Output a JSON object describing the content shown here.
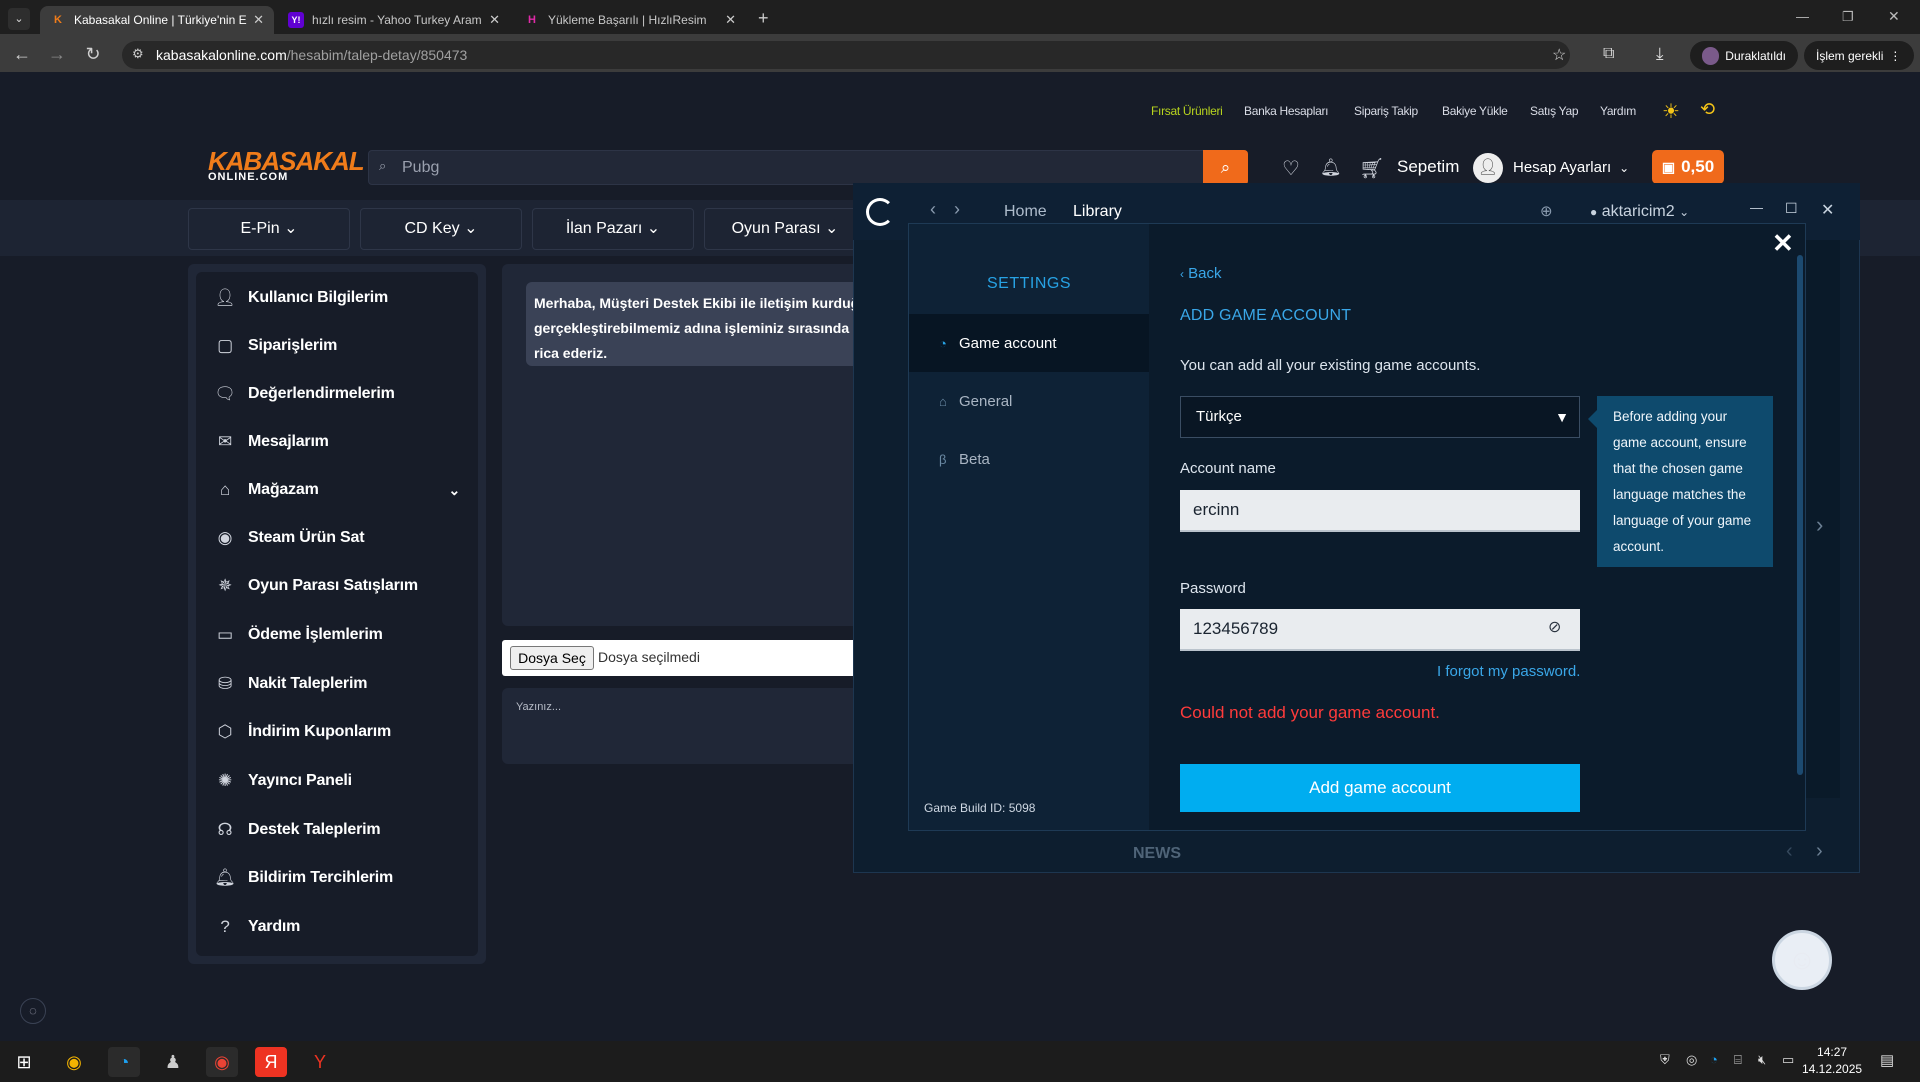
{
  "browser": {
    "tabs": [
      {
        "title": "Kabasakal Online | Türkiye'nin E",
        "favicon": "K"
      },
      {
        "title": "hızlı resim - Yahoo Turkey Aram",
        "favicon": "Y!"
      },
      {
        "title": "Yükleme Başarılı | HızlıResim",
        "favicon": "H"
      }
    ],
    "url_domain": "kabasakalonline.com",
    "url_path": "/hesabim/talep-detay/850473",
    "paused_label": "Duraklatıldı",
    "action_label": "İşlem gerekli"
  },
  "site": {
    "top_links": [
      "Fırsat Ürünleri",
      "Banka Hesapları",
      "Sipariş Takip",
      "Bakiye Yükle",
      "Satış Yap",
      "Yardım"
    ],
    "logo_main": "KABASAKAL",
    "logo_sub": "ONLINE.COM",
    "search_value": "Pubg",
    "cart_label": "Sepetim",
    "account_label": "Hesap Ayarları",
    "balance": "0,50",
    "categories": [
      "E-Pin",
      "CD Key",
      "İlan Pazarı",
      "Oyun Parası"
    ],
    "sidebar": [
      {
        "label": "Kullanıcı Bilgilerim",
        "icon": "user-icon"
      },
      {
        "label": "Siparişlerim",
        "icon": "bag-icon"
      },
      {
        "label": "Değerlendirmelerim",
        "icon": "comment-icon"
      },
      {
        "label": "Mesajlarım",
        "icon": "mail-icon"
      },
      {
        "label": "Mağazam",
        "icon": "store-icon"
      },
      {
        "label": "Steam Ürün Sat",
        "icon": "steam-icon"
      },
      {
        "label": "Oyun Parası Satışlarım",
        "icon": "coins-icon"
      },
      {
        "label": "Ödeme İşlemlerim",
        "icon": "wallet-icon"
      },
      {
        "label": "Nakit Taleplerim",
        "icon": "cash-icon"
      },
      {
        "label": "İndirim Kuponlarım",
        "icon": "coupon-icon"
      },
      {
        "label": "Yayıncı Paneli",
        "icon": "broadcast-icon"
      },
      {
        "label": "Destek Taleplerim",
        "icon": "headset-icon"
      },
      {
        "label": "Bildirim Tercihlerim",
        "icon": "bell-icon"
      },
      {
        "label": "Yardım",
        "icon": "help-icon"
      }
    ],
    "chat_line1": "Merhaba, Müşteri Destek Ekibi ile iletişim kurduğunu",
    "chat_line2": "gerçekleştirebilmemiz adına işleminiz sırasında ald",
    "chat_line3": "rica ederiz.",
    "file_button": "Dosya Seç",
    "file_status": "Dosya seçilmedi",
    "message_placeholder": "Yazınız..."
  },
  "launcher": {
    "nav_home": "Home",
    "nav_library": "Library",
    "username": "aktaricim2",
    "settings_title": "SETTINGS",
    "menu": [
      "Game account",
      "General",
      "Beta"
    ],
    "build_label": "Game Build ID:",
    "build_id": "5098",
    "back": "Back",
    "heading": "ADD GAME ACCOUNT",
    "intro": "You can add all your existing game accounts.",
    "language": "Türkçe",
    "tooltip": "Before adding your game account, ensure that the chosen game language matches the language of your game account.",
    "account_name_label": "Account name",
    "account_name_value": "ercinn",
    "password_label": "Password",
    "password_value": "123456789",
    "forgot": "I forgot my password.",
    "error": "Could not add your game account.",
    "submit": "Add game account",
    "news": "NEWS"
  },
  "taskbar": {
    "time": "14:27",
    "date": "14.12.2025"
  }
}
